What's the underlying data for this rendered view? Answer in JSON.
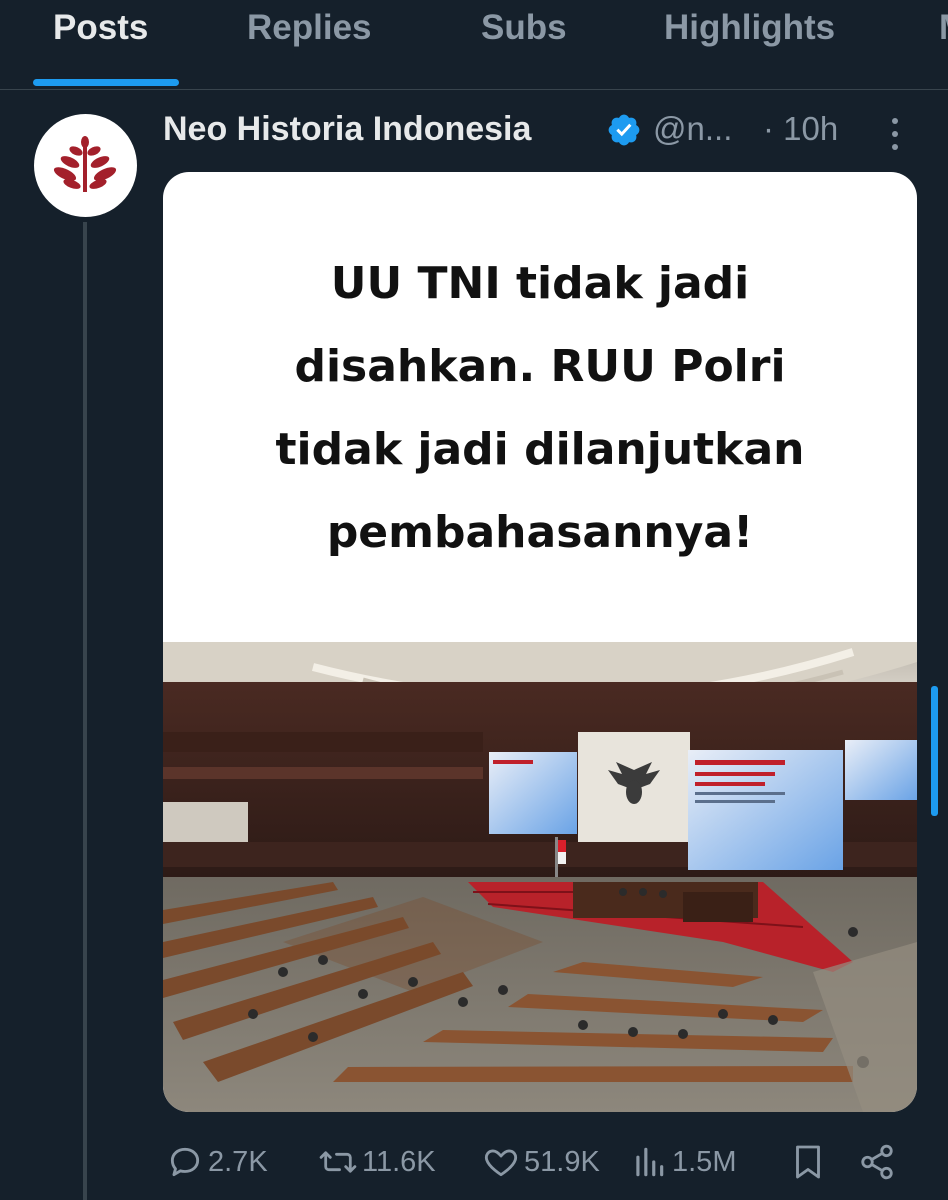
{
  "tabs": [
    {
      "label": "Posts",
      "active": true
    },
    {
      "label": "Replies",
      "active": false
    },
    {
      "label": "Subs",
      "active": false
    },
    {
      "label": "Highlights",
      "active": false
    },
    {
      "label": "M",
      "active": false
    }
  ],
  "post": {
    "author_name": "Neo Historia Indonesia",
    "verified": true,
    "handle": "@n...",
    "time": "· 10h",
    "image_text": [
      "UU TNI tidak jadi",
      "disahkan. RUU Polri",
      "tidak jadi dilanjutkan",
      "pembahasannya!"
    ],
    "actions": {
      "replies": "2.7K",
      "reposts": "11.6K",
      "likes": "51.9K",
      "views": "1.5M"
    }
  },
  "colors": {
    "background": "#15202b",
    "accent": "#1d9bf0",
    "muted_text": "#8b98a5",
    "logo_red": "#a3202b"
  },
  "icons": {
    "avatar": "leaf-logo-icon",
    "verified": "verified-badge-icon",
    "more": "more-vertical-icon",
    "reply": "reply-icon",
    "repost": "repost-icon",
    "like": "heart-icon",
    "views": "views-icon",
    "bookmark": "bookmark-icon",
    "share": "share-icon"
  }
}
